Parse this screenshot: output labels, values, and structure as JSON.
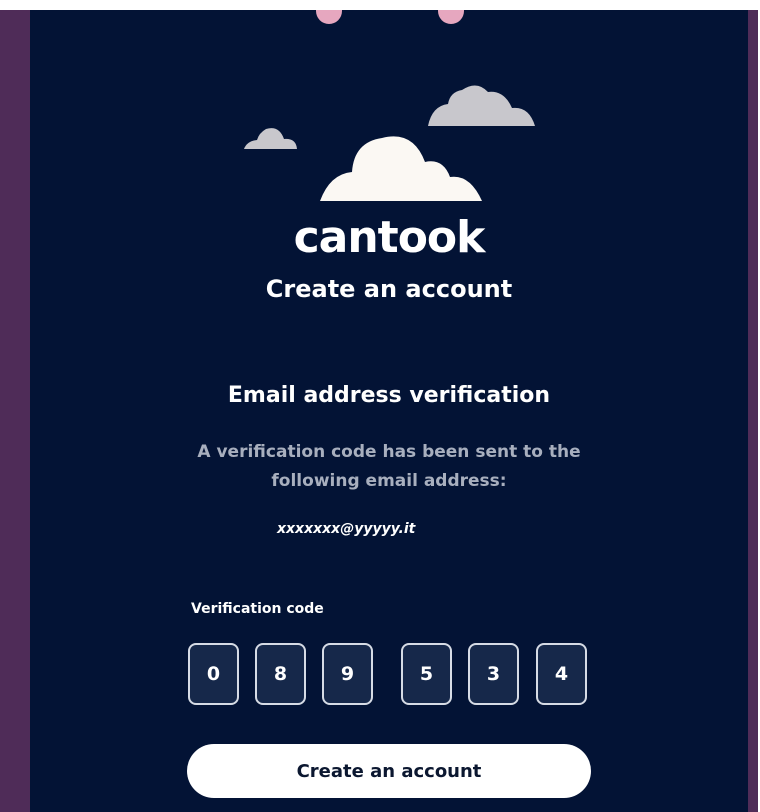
{
  "brand": {
    "logo_text": "cantook"
  },
  "page": {
    "heading": "Create an account",
    "sub_heading": "Email address verification",
    "info_line1": "A verification code has been sent to the",
    "info_line2": "following email address:",
    "email": "xxxxxxx@yyyyy.it"
  },
  "verification": {
    "label": "Verification code",
    "digits": [
      "0",
      "8",
      "9",
      "5",
      "3",
      "4"
    ]
  },
  "actions": {
    "submit_label": "Create an account"
  },
  "colors": {
    "panel_background": "#031335",
    "frame_border": "#4f2c58",
    "cloud_white": "#fbf8f3",
    "cloud_grey": "#c8c7cc",
    "accent_pink": "#e6a7bf",
    "button_background": "#ffffff"
  },
  "icons": [
    "cloud-large-icon",
    "cloud-small-left-icon",
    "cloud-small-right-icon"
  ]
}
